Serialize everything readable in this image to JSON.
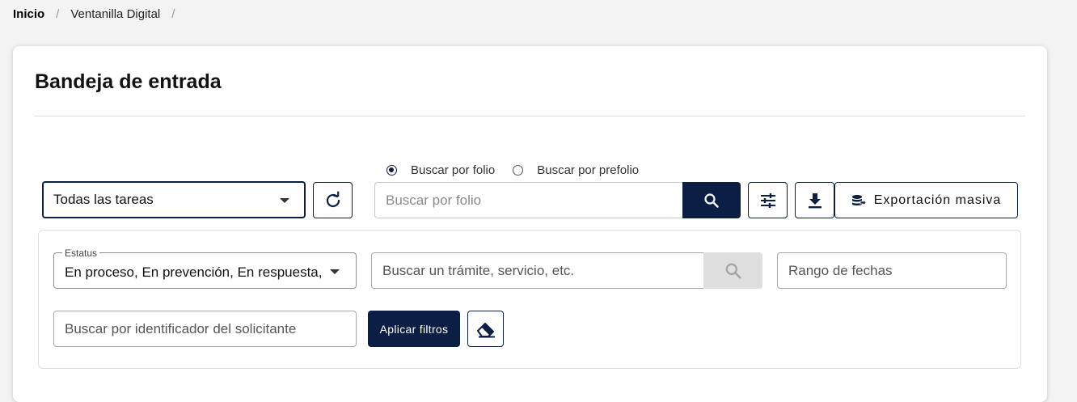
{
  "breadcrumb": {
    "home": "Inicio",
    "separator": "/",
    "current": "Ventanilla Digital"
  },
  "page": {
    "title": "Bandeja de entrada"
  },
  "search_mode": {
    "options": [
      {
        "label": "Buscar por folio",
        "selected": true
      },
      {
        "label": "Buscar por prefolio",
        "selected": false
      }
    ]
  },
  "toolbar": {
    "task_select": "Todas las tareas",
    "folio_placeholder": "Buscar por folio",
    "export_label": "Exportación masiva",
    "icons": {
      "refresh": "refresh-icon",
      "search": "search-icon",
      "filters": "sliders-icon",
      "download": "download-icon",
      "export": "database-export-icon"
    }
  },
  "filters": {
    "status_label": "Estatus",
    "status_value": "En proceso, En prevención, En respuesta, Con resolución",
    "tramite_placeholder": "Buscar un trámite, servicio, etc.",
    "fechas_placeholder": "Rango de fechas",
    "solicitante_placeholder": "Buscar por identificador del solicitante",
    "apply_label": "Aplicar filtros",
    "clear_icon": "eraser-icon"
  },
  "colors": {
    "primary": "#0b1f44",
    "background": "#f3f3f3",
    "disabled": "#dedede"
  }
}
